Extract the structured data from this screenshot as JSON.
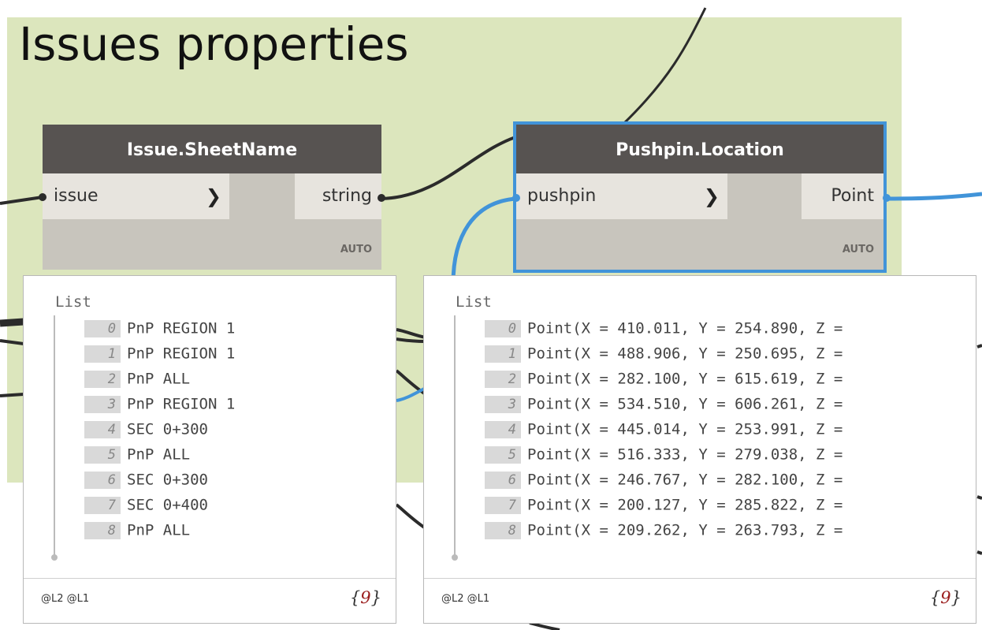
{
  "group": {
    "title": "Issues properties",
    "color": "#dce6bd"
  },
  "nodes": [
    {
      "title": "Issue.SheetName",
      "input": "issue",
      "output": "string",
      "lacing": "AUTO",
      "preview": {
        "list_label": "List",
        "items": [
          {
            "i": "0",
            "v": "PnP REGION 1"
          },
          {
            "i": "1",
            "v": "PnP REGION 1"
          },
          {
            "i": "2",
            "v": "PnP ALL"
          },
          {
            "i": "3",
            "v": "PnP REGION 1"
          },
          {
            "i": "4",
            "v": "SEC 0+300"
          },
          {
            "i": "5",
            "v": "PnP ALL"
          },
          {
            "i": "6",
            "v": "SEC 0+300"
          },
          {
            "i": "7",
            "v": "SEC 0+400"
          },
          {
            "i": "8",
            "v": "PnP ALL"
          }
        ],
        "levels": "@L2 @L1",
        "count_open": "{",
        "count": "9",
        "count_close": "}"
      }
    },
    {
      "title": "Pushpin.Location",
      "input": "pushpin",
      "output": "Point",
      "lacing": "AUTO",
      "selected": true,
      "preview": {
        "list_label": "List",
        "items": [
          {
            "i": "0",
            "v": "Point(X = 410.011, Y = 254.890, Z = "
          },
          {
            "i": "1",
            "v": "Point(X = 488.906, Y = 250.695, Z = "
          },
          {
            "i": "2",
            "v": "Point(X = 282.100, Y = 615.619, Z = "
          },
          {
            "i": "3",
            "v": "Point(X = 534.510, Y = 606.261, Z = "
          },
          {
            "i": "4",
            "v": "Point(X = 445.014, Y = 253.991, Z = "
          },
          {
            "i": "5",
            "v": "Point(X = 516.333, Y = 279.038, Z = "
          },
          {
            "i": "6",
            "v": "Point(X = 246.767, Y = 282.100, Z = "
          },
          {
            "i": "7",
            "v": "Point(X = 200.127, Y = 285.822, Z = "
          },
          {
            "i": "8",
            "v": "Point(X = 209.262, Y = 263.793, Z = "
          }
        ],
        "levels": "@L2 @L1",
        "count_open": "{",
        "count": "9",
        "count_close": "}"
      }
    }
  ],
  "colors": {
    "selection": "#4194d9",
    "header": "#575351",
    "node_body": "#c8c5bd",
    "wire_dark": "#2b2b2b",
    "wire_selected": "#4194d9"
  }
}
